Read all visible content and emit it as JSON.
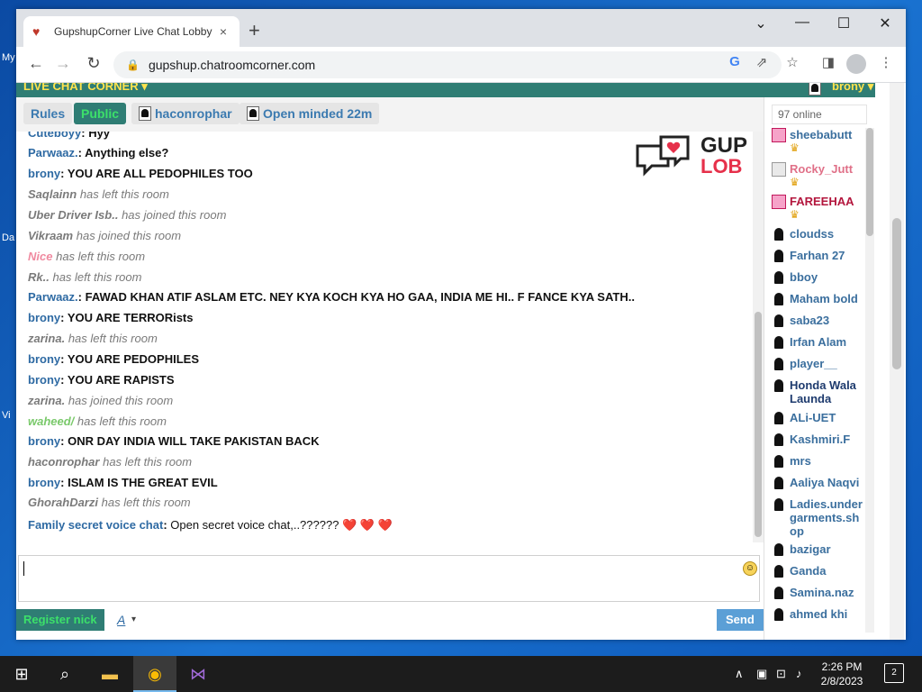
{
  "desktop": {
    "labels": [
      "My",
      "Da",
      "Vi"
    ]
  },
  "browser": {
    "tab_title": "GupshupCorner Live Chat Lobby",
    "tab_close": "×",
    "new_tab": "+",
    "url": "gupshup.chatroomcorner.com",
    "window_controls": {
      "minimize": "—",
      "maximize": "☐",
      "close": "✕",
      "dropdown": "⌄"
    }
  },
  "chat": {
    "brand": "LIVE CHAT CORNER ▾",
    "current_user": "brony ▾",
    "tabs": [
      {
        "label": "Rules"
      },
      {
        "label": "Public"
      },
      {
        "label": "haconrophar"
      },
      {
        "label": "Open minded 22m"
      }
    ],
    "logo": {
      "line1": "GUP",
      "line2": "LOB"
    },
    "messages": [
      {
        "kind": "msg",
        "name": "Cuteboyy",
        "text": "Hyy"
      },
      {
        "kind": "msg",
        "name": "Parwaaz.",
        "text": "Anything else?"
      },
      {
        "kind": "msg",
        "name": "brony",
        "text": "YOU ARE ALL PEDOPHILES TOO"
      },
      {
        "kind": "sys",
        "name": "Saqlainn",
        "text": "has left this room"
      },
      {
        "kind": "sys",
        "name": "Uber Driver Isb..",
        "text": "has joined this room"
      },
      {
        "kind": "sys",
        "name": "Vikraam",
        "text": "has joined this room"
      },
      {
        "kind": "sys",
        "name": "Nice",
        "text": "has left this room",
        "color": "#f08aa0"
      },
      {
        "kind": "sys",
        "name": "Rk..",
        "text": "has left this room"
      },
      {
        "kind": "msg",
        "name": "Parwaaz.",
        "text": "FAWAD KHAN ATIF ASLAM ETC. NEY KYA KOCH KYA HO GAA, INDIA ME HI.. F FANCE KYA SATH.."
      },
      {
        "kind": "msg",
        "name": "brony",
        "text": "YOU ARE TERRORists"
      },
      {
        "kind": "sys",
        "name": "zarina.",
        "text": "has left this room"
      },
      {
        "kind": "msg",
        "name": "brony",
        "text": "YOU ARE PEDOPHILES"
      },
      {
        "kind": "msg",
        "name": "brony",
        "text": "YOU ARE RAPISTS"
      },
      {
        "kind": "sys",
        "name": "zarina.",
        "text": "has joined this room"
      },
      {
        "kind": "sys",
        "name": "waheed/",
        "text": "has left this room",
        "color": "#7ac96b"
      },
      {
        "kind": "msg",
        "name": "brony",
        "text": "ONR DAY INDIA WILL TAKE PAKISTAN BACK"
      },
      {
        "kind": "sys",
        "name": "haconrophar",
        "text": "has left this room"
      },
      {
        "kind": "msg",
        "name": "brony",
        "text": "ISLAM IS THE GREAT EVIL"
      },
      {
        "kind": "sys",
        "name": "GhorahDarzi",
        "text": "has left this room"
      },
      {
        "kind": "msg",
        "name": "Family secret voice chat",
        "text": "Open secret voice chat,..?????? ❤️ ❤️ ❤️",
        "plain": true
      }
    ],
    "input_placeholder": "",
    "register_label": "Register nick",
    "font_label": "A",
    "send_label": "Send"
  },
  "sidebar": {
    "online_count": "97 online",
    "users": [
      {
        "name": "sheebabutt",
        "icon": "female",
        "crown": true,
        "color": "blue"
      },
      {
        "name": "Rocky_Jutt",
        "icon": "guest",
        "crown": true,
        "color": "pink"
      },
      {
        "name": "FAREEHAA",
        "icon": "female",
        "crown": true,
        "color": "red"
      },
      {
        "name": "cloudss",
        "icon": "male"
      },
      {
        "name": "Farhan 27",
        "icon": "male"
      },
      {
        "name": "bboy",
        "icon": "male"
      },
      {
        "name": "Maham bold",
        "icon": "male"
      },
      {
        "name": "saba23",
        "icon": "male"
      },
      {
        "name": "Irfan Alam",
        "icon": "male"
      },
      {
        "name": "player__",
        "icon": "male"
      },
      {
        "name": "Honda Wala Launda",
        "icon": "male",
        "dark": true
      },
      {
        "name": "ALi-UET",
        "icon": "male"
      },
      {
        "name": "Kashmiri.F",
        "icon": "male"
      },
      {
        "name": "mrs",
        "icon": "male"
      },
      {
        "name": "Aaliya Naqvi",
        "icon": "male"
      },
      {
        "name": "Ladies.undergarments.shop",
        "icon": "male"
      },
      {
        "name": "bazigar",
        "icon": "male"
      },
      {
        "name": "Ganda",
        "icon": "male"
      },
      {
        "name": "Samina.naz",
        "icon": "male"
      },
      {
        "name": "ahmed khi",
        "icon": "male"
      }
    ]
  },
  "taskbar": {
    "time": "2:26 PM",
    "date": "2/8/2023",
    "notifications": "2"
  },
  "colors": {
    "accent": "#2f7d74",
    "brand_text": "#ffe34d",
    "active_tab_text": "#3ce06a",
    "username": "#2e6aa3"
  }
}
